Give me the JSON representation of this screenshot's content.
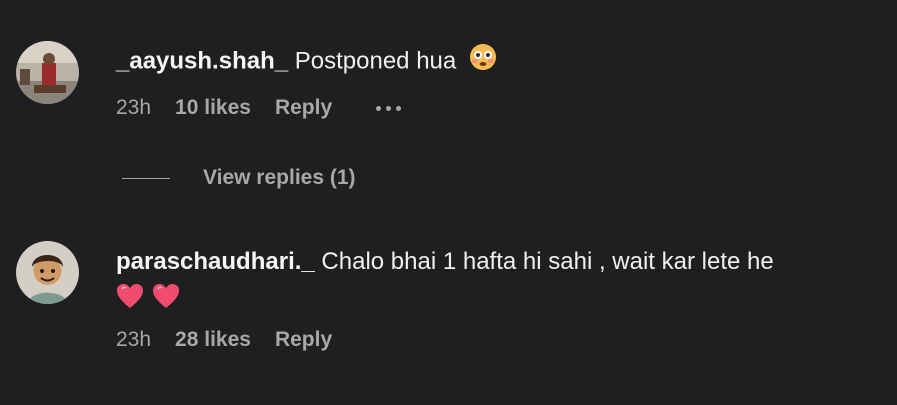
{
  "comments": [
    {
      "username": "_aayush.shah_",
      "text": "Postponed hua",
      "emoji": "flushed-face",
      "time": "23h",
      "likes": "10 likes",
      "reply": "Reply"
    },
    {
      "username": "paraschaudhari._",
      "text": "Chalo bhai 1 hafta hi sahi , wait kar lete he",
      "emoji": "heart-icon",
      "time": "23h",
      "likes": "28 likes",
      "reply": "Reply"
    }
  ],
  "view_replies": "View replies (1)",
  "colors": {
    "background": "#1f1f22",
    "text_primary": "#f2f2f2",
    "text_secondary": "#a8a8a8",
    "heart": "#f04d6e"
  }
}
